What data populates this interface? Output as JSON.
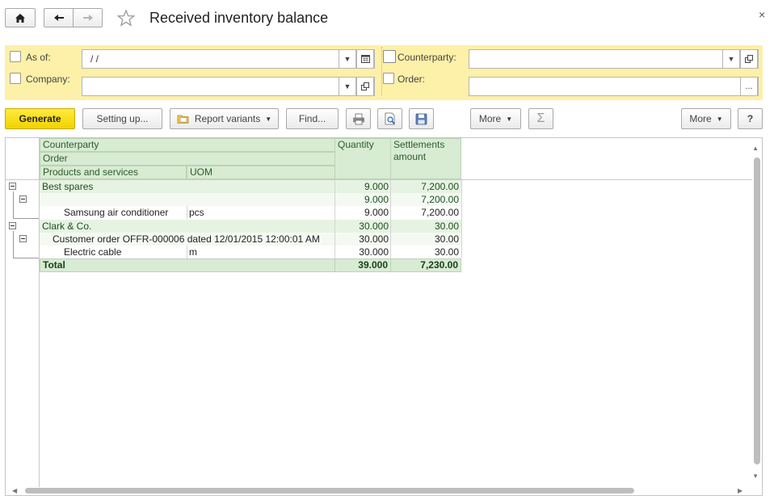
{
  "window": {
    "title": "Received inventory balance",
    "close_glyph": "×"
  },
  "nav": {
    "home_icon": "home-icon",
    "back_icon": "arrow-left-icon",
    "forward_icon": "arrow-right-icon",
    "favorite_icon": "star-icon"
  },
  "filters": {
    "as_of": {
      "label": "As of:",
      "value": " /  /"
    },
    "company": {
      "label": "Company:",
      "value": ""
    },
    "counterparty": {
      "label": "Counterparty:",
      "value": ""
    },
    "order": {
      "label": "Order:",
      "value": "",
      "choose_glyph": "..."
    }
  },
  "toolbar": {
    "generate": "Generate",
    "setting_up": "Setting up...",
    "report_variants": "Report variants",
    "find": "Find...",
    "more_left": "More",
    "sum_glyph": "Σ",
    "more_right": "More",
    "help": "?"
  },
  "report": {
    "headers": {
      "counterparty": "Counterparty",
      "order": "Order",
      "products": "Products and services",
      "uom": "UOM",
      "quantity": "Quantity",
      "settlements_line1": "Settlements",
      "settlements_line2": "amount"
    },
    "rows": [
      {
        "name": "Best spares",
        "uom": "",
        "quantity": "9.000",
        "amount": "7,200.00"
      },
      {
        "name": "",
        "uom": "",
        "quantity": "9.000",
        "amount": "7,200.00"
      },
      {
        "name": "Samsung air conditioner",
        "uom": "pcs",
        "quantity": "9.000",
        "amount": "7,200.00"
      },
      {
        "name": "Clark & Co.",
        "uom": "",
        "quantity": "30.000",
        "amount": "30.00"
      },
      {
        "name": "Customer order OFFR-000006 dated 12/01/2015 12:00:01 AM",
        "uom": "",
        "quantity": "30.000",
        "amount": "30.00"
      },
      {
        "name": "Electric cable",
        "uom": "m",
        "quantity": "30.000",
        "amount": "30.00"
      }
    ],
    "total": {
      "label": "Total",
      "quantity": "39.000",
      "amount": "7,230.00"
    }
  }
}
